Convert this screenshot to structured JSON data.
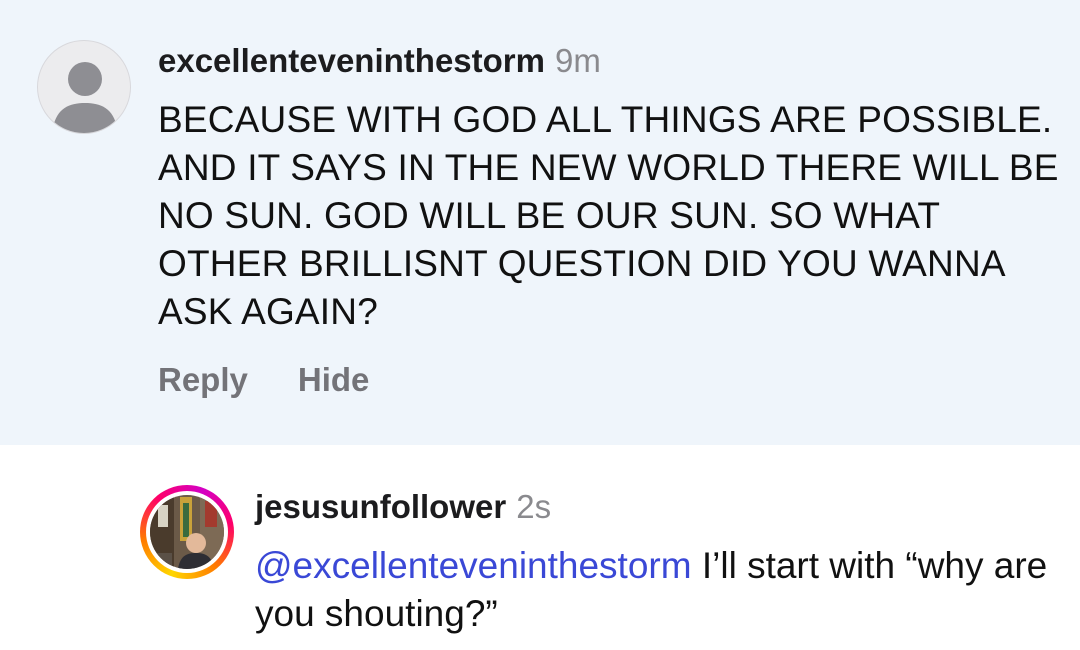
{
  "comments": [
    {
      "username": "excellenteveninthestorm",
      "time": "9m",
      "text": "BECAUSE WITH GOD ALL THINGS ARE POSSIBLE. AND IT SAYS IN THE NEW WORLD THERE WILL BE NO SUN. GOD WILL BE OUR SUN. SO WHAT OTHER BRILLISNT QUESTION DID YOU WANNA ASK AGAIN?",
      "avatar_icon": "default-user-icon",
      "highlight_color": "#eff5fb",
      "actions": {
        "reply": "Reply",
        "hide": "Hide"
      }
    },
    {
      "username": "jesusunfollower",
      "time": "2s",
      "mention": "@excellenteveninthestorm",
      "text": " I’ll start with “why are you shouting?”",
      "avatar_icon": "profile-photo",
      "mention_color": "#3a48d6"
    }
  ]
}
